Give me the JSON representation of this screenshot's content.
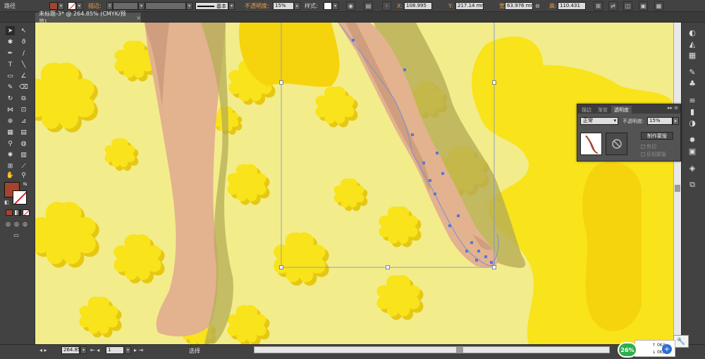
{
  "control": {
    "object_type": "路径",
    "stroke_label": "描边:",
    "stroke_profile": "基本",
    "opacity_label": "不透明度:",
    "opacity_value": "15%",
    "style_label": "样式:",
    "x_label": "X:",
    "x_value": "108.995",
    "y_label": "Y:",
    "y_value": "217.14 mm",
    "w_label": "宽:",
    "w_value": "63.976 mm",
    "h_label": "高:",
    "h_value": "110.431",
    "fill_color": "#a3442e"
  },
  "document": {
    "tab_title": "未标题-3* @ 264.85% (CMYK/预览)",
    "close_glyph": "×"
  },
  "transparency_panel": {
    "tabs": [
      "描边",
      "渐变",
      "透明度"
    ],
    "menu_glyph": "▸▸ ≡",
    "blend_mode": "正常",
    "opacity_label": "不透明度:",
    "opacity_value": "15%",
    "make_mask_label": "制作蒙版",
    "clip_label": "剪切",
    "invert_label": "反相蒙版"
  },
  "status": {
    "zoom": "264.85",
    "page": "1",
    "tool_status": "选择",
    "net_percent": "26%",
    "net_up": "0K/s",
    "net_down": "0K/s"
  },
  "colors": {
    "canvas_bg": "#f3ec8a",
    "blob_yellow": "#f9e31a",
    "blob_shadow": "#e6c812",
    "skin": "#e3b28f",
    "skin_shadow": "#cf9e7e",
    "olive_shadow": "#b5ad55",
    "selection": "#7b8fd4"
  }
}
